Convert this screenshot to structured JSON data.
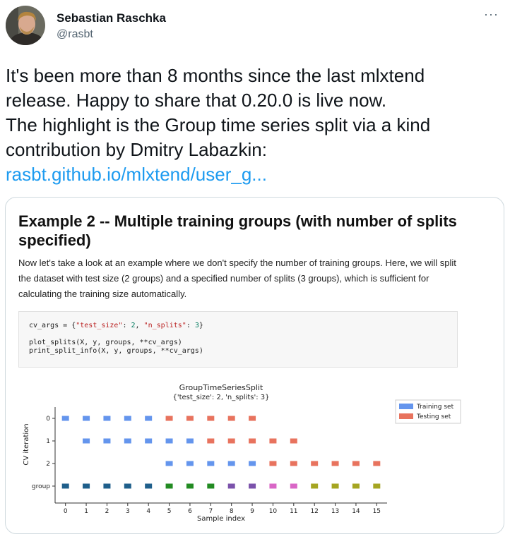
{
  "author": {
    "name": "Sebastian Raschka",
    "handle": "@rasbt"
  },
  "menu": {
    "more_label": "···"
  },
  "tweet": {
    "lines": [
      "It's been more than 8 months since the last mlxtend",
      "release. Happy to share that 0.20.0 is live now.",
      "The highlight is the Group time series split via a kind",
      "contribution by Dmitry Labazkin:"
    ],
    "link": "rasbt.github.io/mlxtend/user_g..."
  },
  "media": {
    "heading_line1": "Example 2 -- Multiple training groups (with number of splits",
    "heading_line2": "specified)",
    "paragraph_lines": [
      "Now let's take a look at an example where we don't specify the number of training groups. Here, we will split",
      "the dataset with test size (2 groups) and a specified number of splits (3 groups), which is sufficient for",
      "calculating the training size automatically."
    ],
    "code": {
      "line1_pre": "cv_args = {",
      "key1": "\"test_size\"",
      "sep1": ": ",
      "val1": "2",
      "sep2": ", ",
      "key2": "\"n_splits\"",
      "sep3": ": ",
      "val2": "3",
      "line1_post": "}",
      "line3": "plot_splits(X, y, groups, **cv_args)",
      "line4": "print_split_info(X, y, groups, **cv_args)"
    }
  },
  "chart_data": {
    "type": "scatter",
    "title": "GroupTimeSeriesSplit",
    "subtitle": "{'test_size': 2, 'n_splits': 3}",
    "xlabel": "Sample index",
    "ylabel": "CV iteration",
    "x_ticks": [
      0,
      1,
      2,
      3,
      4,
      5,
      6,
      7,
      8,
      9,
      10,
      11,
      12,
      13,
      14,
      15
    ],
    "y_tick_labels": [
      "0",
      "1",
      "2",
      "group"
    ],
    "xlim": [
      -0.5,
      15.5
    ],
    "legend_position": "top-right",
    "legend": [
      {
        "name": "Training set",
        "color": "#6495ed"
      },
      {
        "name": "Testing set",
        "color": "#e8735e"
      }
    ],
    "rows": [
      {
        "label": "0",
        "train": [
          0,
          1,
          2,
          3,
          4
        ],
        "test": [
          5,
          6,
          7,
          8,
          9
        ]
      },
      {
        "label": "1",
        "train": [
          1,
          2,
          3,
          4,
          5,
          6
        ],
        "test": [
          7,
          8,
          9,
          10,
          11
        ]
      },
      {
        "label": "2",
        "train": [
          5,
          6,
          7,
          8,
          9
        ],
        "test": [
          10,
          11,
          12,
          13,
          14,
          15
        ]
      }
    ],
    "groups": [
      0,
      0,
      0,
      0,
      0,
      1,
      1,
      1,
      2,
      2,
      3,
      3,
      4,
      4,
      4,
      4
    ],
    "group_colors": [
      "#1f5f8b",
      "#228b22",
      "#7b52ab",
      "#d966c6",
      "#a5a521",
      "#79cbdd"
    ],
    "train_color": "#6495ed",
    "test_color": "#e8735e"
  }
}
